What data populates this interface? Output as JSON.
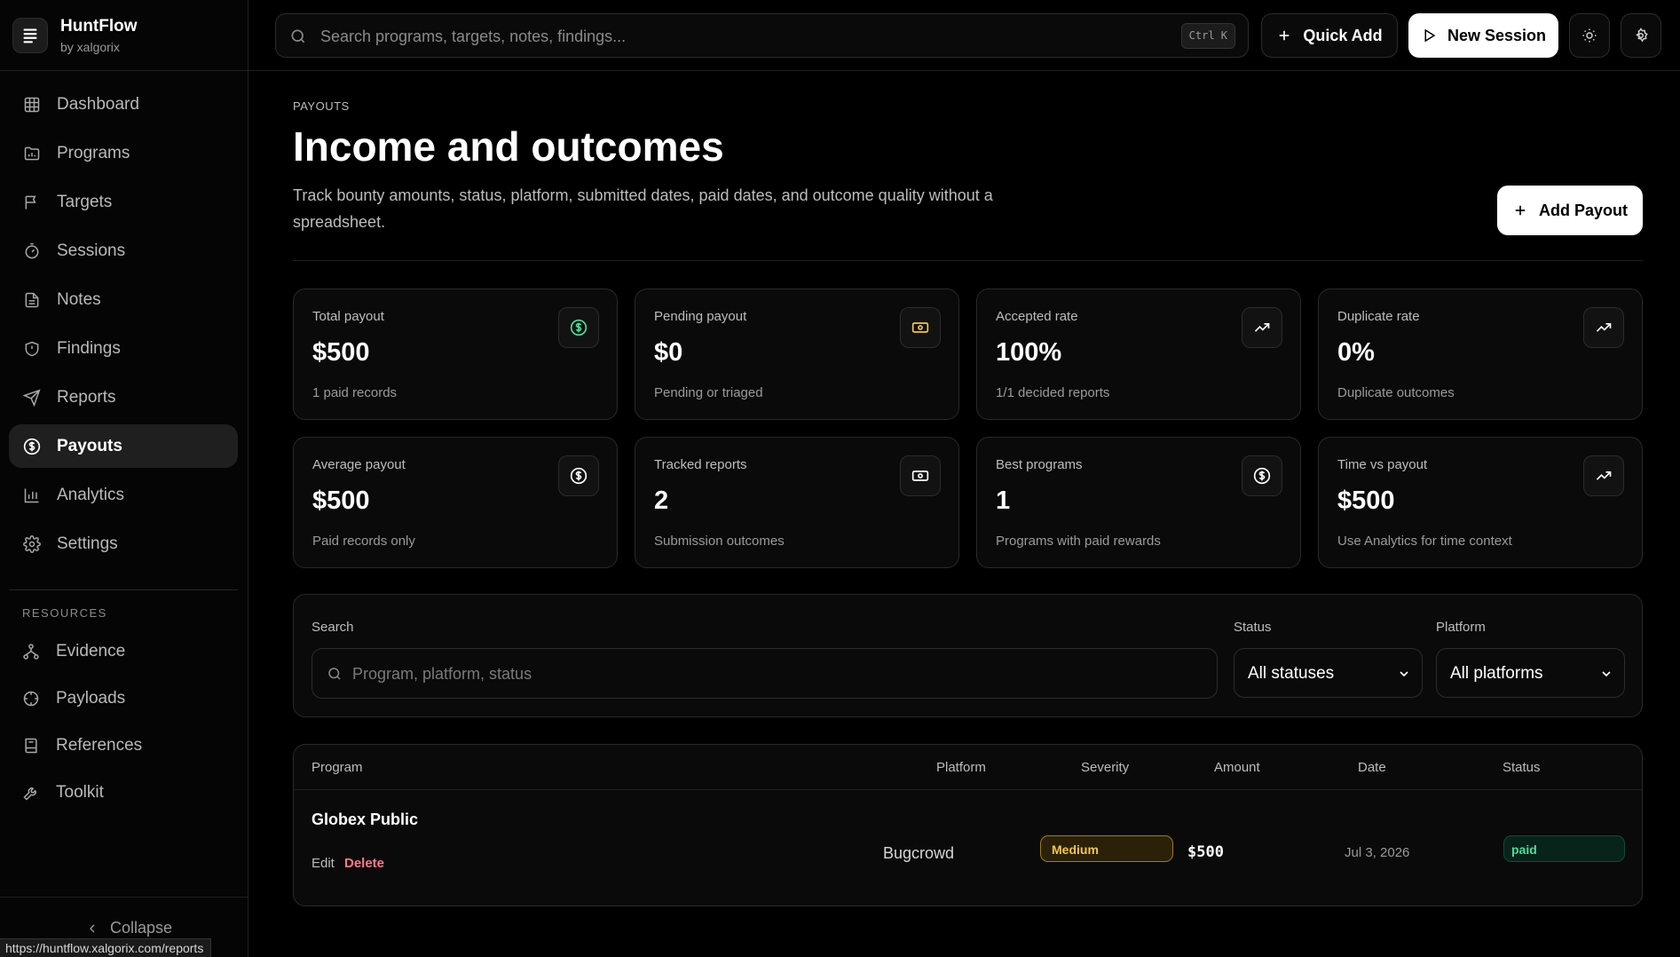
{
  "brand": {
    "name": "HuntFlow",
    "sub": "by xalgorix"
  },
  "nav": [
    {
      "label": "Dashboard",
      "icon": "dashboard-icon"
    },
    {
      "label": "Programs",
      "icon": "programs-icon"
    },
    {
      "label": "Targets",
      "icon": "flag-icon"
    },
    {
      "label": "Sessions",
      "icon": "timer-icon"
    },
    {
      "label": "Notes",
      "icon": "note-icon"
    },
    {
      "label": "Findings",
      "icon": "shield-icon"
    },
    {
      "label": "Reports",
      "icon": "send-icon"
    },
    {
      "label": "Payouts",
      "icon": "dollar-circle-icon",
      "active": true
    },
    {
      "label": "Analytics",
      "icon": "bar-chart-icon"
    },
    {
      "label": "Settings",
      "icon": "gear-icon"
    }
  ],
  "resources": {
    "title": "RESOURCES",
    "items": [
      {
        "label": "Evidence",
        "icon": "network-icon"
      },
      {
        "label": "Payloads",
        "icon": "crosshair-icon"
      },
      {
        "label": "References",
        "icon": "book-icon"
      },
      {
        "label": "Toolkit",
        "icon": "wrench-icon"
      }
    ]
  },
  "collapse_label": "Collapse",
  "status_url": "https://huntflow.xalgorix.com/reports",
  "topbar": {
    "search_placeholder": "Search programs, targets, notes, findings...",
    "shortcut": "Ctrl K",
    "quick_add": "Quick Add",
    "new_session": "New Session"
  },
  "page": {
    "eyebrow": "PAYOUTS",
    "title": "Income and outcomes",
    "description": "Track bounty amounts, status, platform, submitted dates, paid dates, and outcome quality without a spreadsheet.",
    "add_button": "Add Payout"
  },
  "stats": [
    {
      "label": "Total payout",
      "value": "$500",
      "sub": "1 paid records",
      "icon": "dollar-circle-icon",
      "icon_color": "#4ade9c"
    },
    {
      "label": "Pending payout",
      "value": "$0",
      "sub": "Pending or triaged",
      "icon": "banknote-icon",
      "icon_color": "#f5c54a"
    },
    {
      "label": "Accepted rate",
      "value": "100%",
      "sub": "1/1 decided reports",
      "icon": "trending-up-icon",
      "icon_color": "#ffffff"
    },
    {
      "label": "Duplicate rate",
      "value": "0%",
      "sub": "Duplicate outcomes",
      "icon": "trending-up-icon",
      "icon_color": "#ffffff"
    },
    {
      "label": "Average payout",
      "value": "$500",
      "sub": "Paid records only",
      "icon": "dollar-circle-icon",
      "icon_color": "#ffffff"
    },
    {
      "label": "Tracked reports",
      "value": "2",
      "sub": "Submission outcomes",
      "icon": "banknote-icon",
      "icon_color": "#ffffff"
    },
    {
      "label": "Best programs",
      "value": "1",
      "sub": "Programs with paid rewards",
      "icon": "dollar-circle-icon",
      "icon_color": "#ffffff"
    },
    {
      "label": "Time vs payout",
      "value": "$500",
      "sub": "Use Analytics for time context",
      "icon": "trending-up-icon",
      "icon_color": "#ffffff"
    }
  ],
  "filters": {
    "search_label": "Search",
    "search_placeholder": "Program, platform, status",
    "status_label": "Status",
    "status_value": "All statuses",
    "platform_label": "Platform",
    "platform_value": "All platforms"
  },
  "table": {
    "headers": {
      "program": "Program",
      "platform": "Platform",
      "severity": "Severity",
      "amount": "Amount",
      "date": "Date",
      "status": "Status"
    },
    "rows": [
      {
        "program": "Globex Public",
        "edit": "Edit",
        "delete": "Delete",
        "platform": "Bugcrowd",
        "severity": "Medium",
        "amount": "$500",
        "date": "Jul 3, 2026",
        "status": "paid"
      }
    ]
  }
}
